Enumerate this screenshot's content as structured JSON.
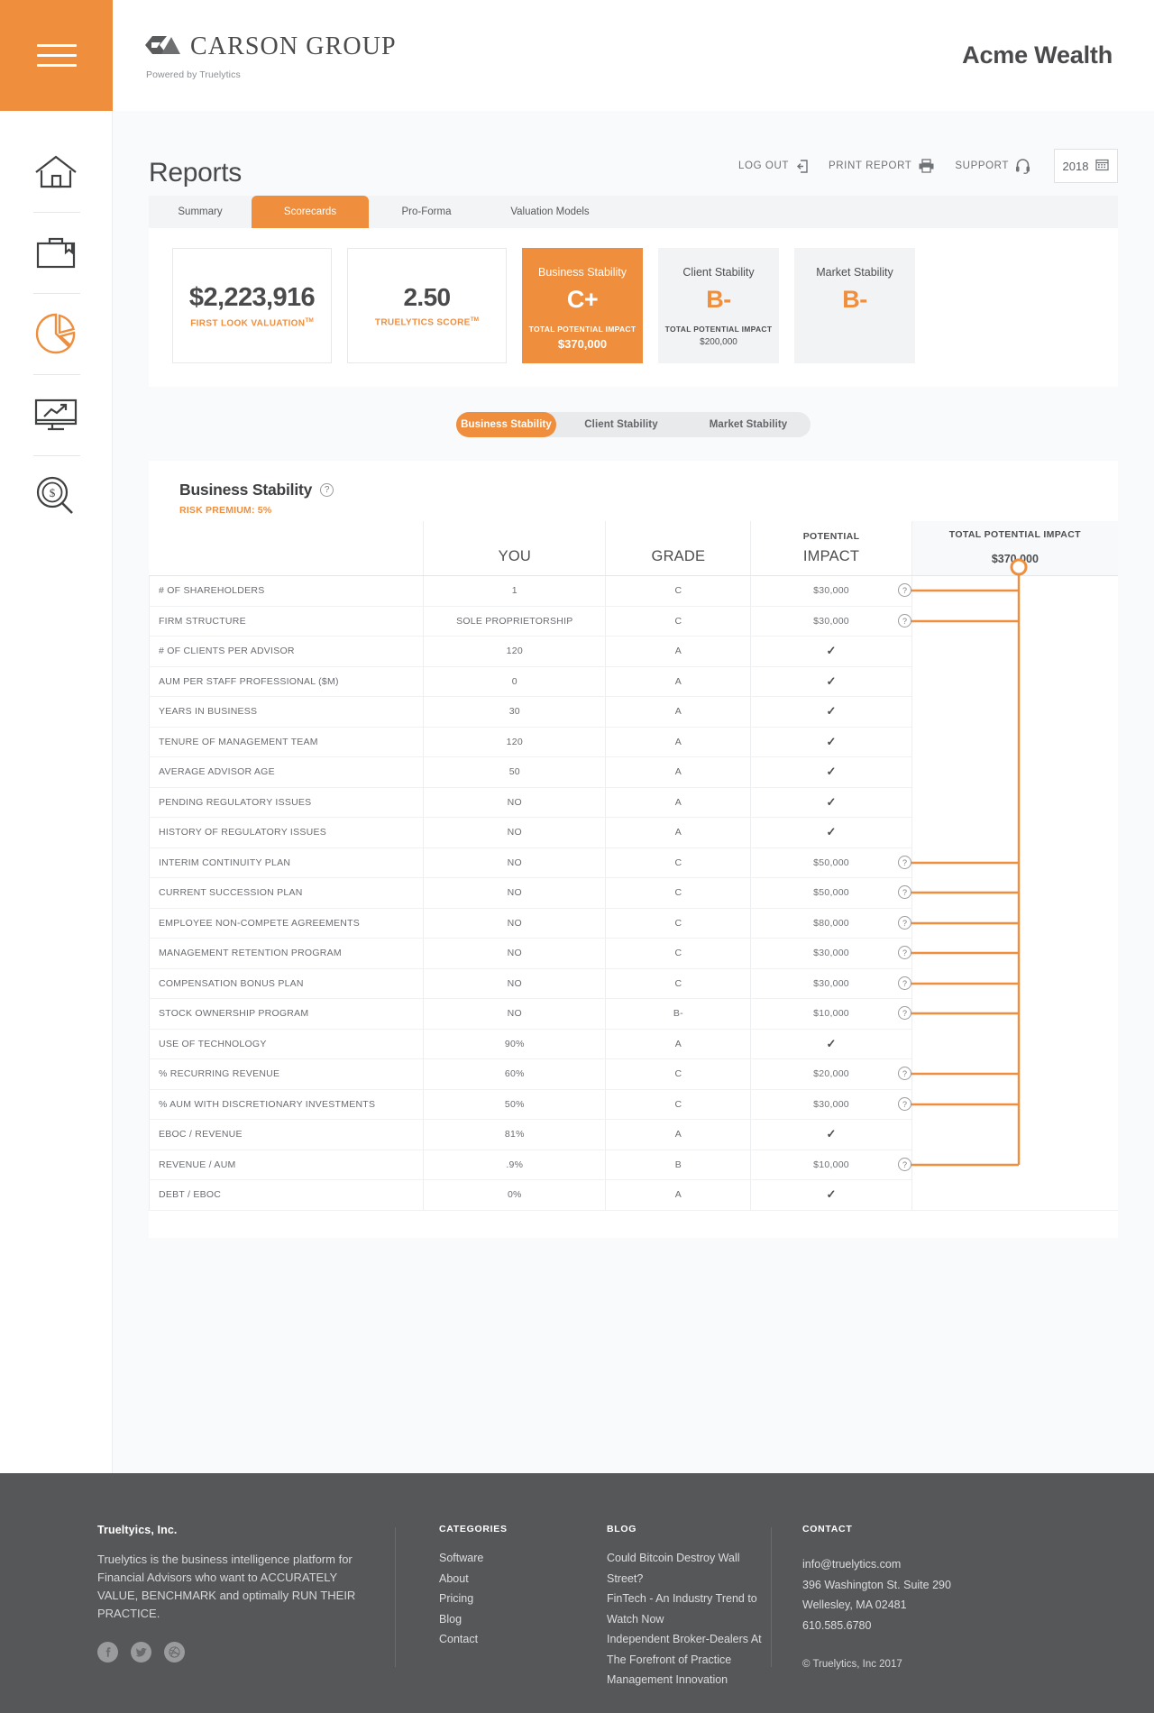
{
  "brand": {
    "logo_icon": "carson-group-mark-icon",
    "name": "CARSON GROUP",
    "tagline": "Powered by Truelytics",
    "account_name": "Acme Wealth",
    "accent": "#ef8e3d"
  },
  "sidebar": {
    "menu_icon": "hamburger-menu-icon",
    "items": [
      {
        "icon": "home-icon",
        "label": "Home",
        "active": false
      },
      {
        "icon": "briefcase-icon",
        "label": "Practice",
        "active": false
      },
      {
        "icon": "pie-chart-icon",
        "label": "Reports",
        "active": true
      },
      {
        "icon": "monitor-trend-icon",
        "label": "Benchmarks",
        "active": false
      },
      {
        "icon": "magnifier-dollar-icon",
        "label": "Valuation",
        "active": false
      }
    ]
  },
  "header": {
    "page_title": "Reports",
    "tools": [
      {
        "label": "LOG OUT",
        "icon": "logout-icon"
      },
      {
        "label": "PRINT REPORT",
        "icon": "printer-icon"
      },
      {
        "label": "SUPPORT",
        "icon": "headset-icon"
      }
    ],
    "year_selector": {
      "value": "2018",
      "icon": "calendar-icon"
    }
  },
  "tabs": [
    {
      "label": "Summary",
      "active": false
    },
    {
      "label": "Scorecards",
      "active": true
    },
    {
      "label": "Pro-Forma",
      "active": false
    },
    {
      "label": "Valuation Models",
      "active": false
    }
  ],
  "kpis": [
    {
      "value": "$2,223,916",
      "label": "FIRST LOOK VALUATION",
      "tm": "TM"
    },
    {
      "value": "2.50",
      "label": "TRUELYTICS SCORE",
      "tm": "TM"
    }
  ],
  "grade_cards": [
    {
      "title": "Business Stability",
      "grade": "C+",
      "impact_label": "TOTAL POTENTIAL IMPACT",
      "impact_value": "$370,000",
      "active": true
    },
    {
      "title": "Client Stability",
      "grade": "B-",
      "impact_label": "TOTAL POTENTIAL IMPACT",
      "impact_value": "$200,000",
      "active": false
    },
    {
      "title": "Market Stability",
      "grade": "B-",
      "impact_label": "",
      "impact_value": "",
      "active": false
    }
  ],
  "segmented": [
    {
      "label": "Business Stability",
      "active": true
    },
    {
      "label": "Client Stability",
      "active": false
    },
    {
      "label": "Market Stability",
      "active": false
    }
  ],
  "scorecard": {
    "title": "Business Stability",
    "help_icon": "question-mark-icon",
    "risk_premium": "RISK PREMIUM: 5%",
    "columns": {
      "item": "",
      "you": "YOU",
      "grade": "GRADE",
      "impact_small": "POTENTIAL",
      "impact_main": "IMPACT",
      "total_label": "TOTAL POTENTIAL IMPACT",
      "total_value": "$370,000"
    },
    "rows": [
      {
        "item": "# OF SHAREHOLDERS",
        "you": "1",
        "grade": "C",
        "impact": "$30,000",
        "flagged": true
      },
      {
        "item": "FIRM STRUCTURE",
        "you": "SOLE PROPRIETORSHIP",
        "grade": "C",
        "impact": "$30,000",
        "flagged": true
      },
      {
        "item": "# OF CLIENTS PER ADVISOR",
        "you": "120",
        "grade": "A",
        "impact": "",
        "flagged": false
      },
      {
        "item": "AUM PER STAFF PROFESSIONAL ($M)",
        "you": "0",
        "grade": "A",
        "impact": "",
        "flagged": false
      },
      {
        "item": "YEARS IN BUSINESS",
        "you": "30",
        "grade": "A",
        "impact": "",
        "flagged": false
      },
      {
        "item": "TENURE OF MANAGEMENT TEAM",
        "you": "120",
        "grade": "A",
        "impact": "",
        "flagged": false
      },
      {
        "item": "AVERAGE ADVISOR AGE",
        "you": "50",
        "grade": "A",
        "impact": "",
        "flagged": false
      },
      {
        "item": "PENDING REGULATORY ISSUES",
        "you": "NO",
        "grade": "A",
        "impact": "",
        "flagged": false
      },
      {
        "item": "HISTORY OF REGULATORY ISSUES",
        "you": "NO",
        "grade": "A",
        "impact": "",
        "flagged": false
      },
      {
        "item": "INTERIM CONTINUITY PLAN",
        "you": "NO",
        "grade": "C",
        "impact": "$50,000",
        "flagged": true
      },
      {
        "item": "CURRENT SUCCESSION PLAN",
        "you": "NO",
        "grade": "C",
        "impact": "$50,000",
        "flagged": true
      },
      {
        "item": "EMPLOYEE NON-COMPETE AGREEMENTS",
        "you": "NO",
        "grade": "C",
        "impact": "$80,000",
        "flagged": true
      },
      {
        "item": "MANAGEMENT RETENTION PROGRAM",
        "you": "NO",
        "grade": "C",
        "impact": "$30,000",
        "flagged": true
      },
      {
        "item": "COMPENSATION BONUS PLAN",
        "you": "NO",
        "grade": "C",
        "impact": "$30,000",
        "flagged": true
      },
      {
        "item": "STOCK OWNERSHIP PROGRAM",
        "you": "NO",
        "grade": "B-",
        "impact": "$10,000",
        "flagged": true
      },
      {
        "item": "USE OF TECHNOLOGY",
        "you": "90%",
        "grade": "A",
        "impact": "",
        "flagged": false
      },
      {
        "item": "% RECURRING REVENUE",
        "you": "60%",
        "grade": "C",
        "impact": "$20,000",
        "flagged": true
      },
      {
        "item": "% AUM WITH DISCRETIONARY INVESTMENTS",
        "you": "50%",
        "grade": "C",
        "impact": "$30,000",
        "flagged": true
      },
      {
        "item": "EBOC / REVENUE",
        "you": "81%",
        "grade": "A",
        "impact": "",
        "flagged": false
      },
      {
        "item": "REVENUE / AUM",
        "you": ".9%",
        "grade": "B",
        "impact": "$10,000",
        "flagged": true
      },
      {
        "item": "DEBT / EBOC",
        "you": "0%",
        "grade": "A",
        "impact": "",
        "flagged": false
      }
    ],
    "check_glyph": "✓",
    "flag_glyph": "?"
  },
  "footer": {
    "about": {
      "title": "Trueltyics, Inc.",
      "body": "Truelytics is the business intelligence platform for Financial Advisors who want to ACCURATELY VALUE, BENCHMARK and optimally RUN THEIR PRACTICE.",
      "social": [
        {
          "icon": "facebook-icon",
          "glyph": "f"
        },
        {
          "icon": "twitter-icon",
          "glyph": "t"
        },
        {
          "icon": "dribbble-icon",
          "glyph": "d"
        }
      ]
    },
    "categories": {
      "heading": "CATEGORIES",
      "items": [
        "Software",
        "About",
        "Pricing",
        "Blog",
        "Contact"
      ]
    },
    "blog": {
      "heading": "BLOG",
      "items": [
        "Could Bitcoin Destroy Wall Street?",
        "FinTech - An Industry Trend to",
        "Watch Now",
        "Independent Broker-Dealers At",
        "The Forefront of Practice",
        "Management Innovation"
      ]
    },
    "contact": {
      "heading": "CONTACT",
      "items": [
        "info@truelytics.com",
        "396 Washington St. Suite 290",
        "Wellesley, MA 02481",
        " 610.585.6780"
      ],
      "copyright": "© Truelytics, Inc  2017"
    }
  }
}
